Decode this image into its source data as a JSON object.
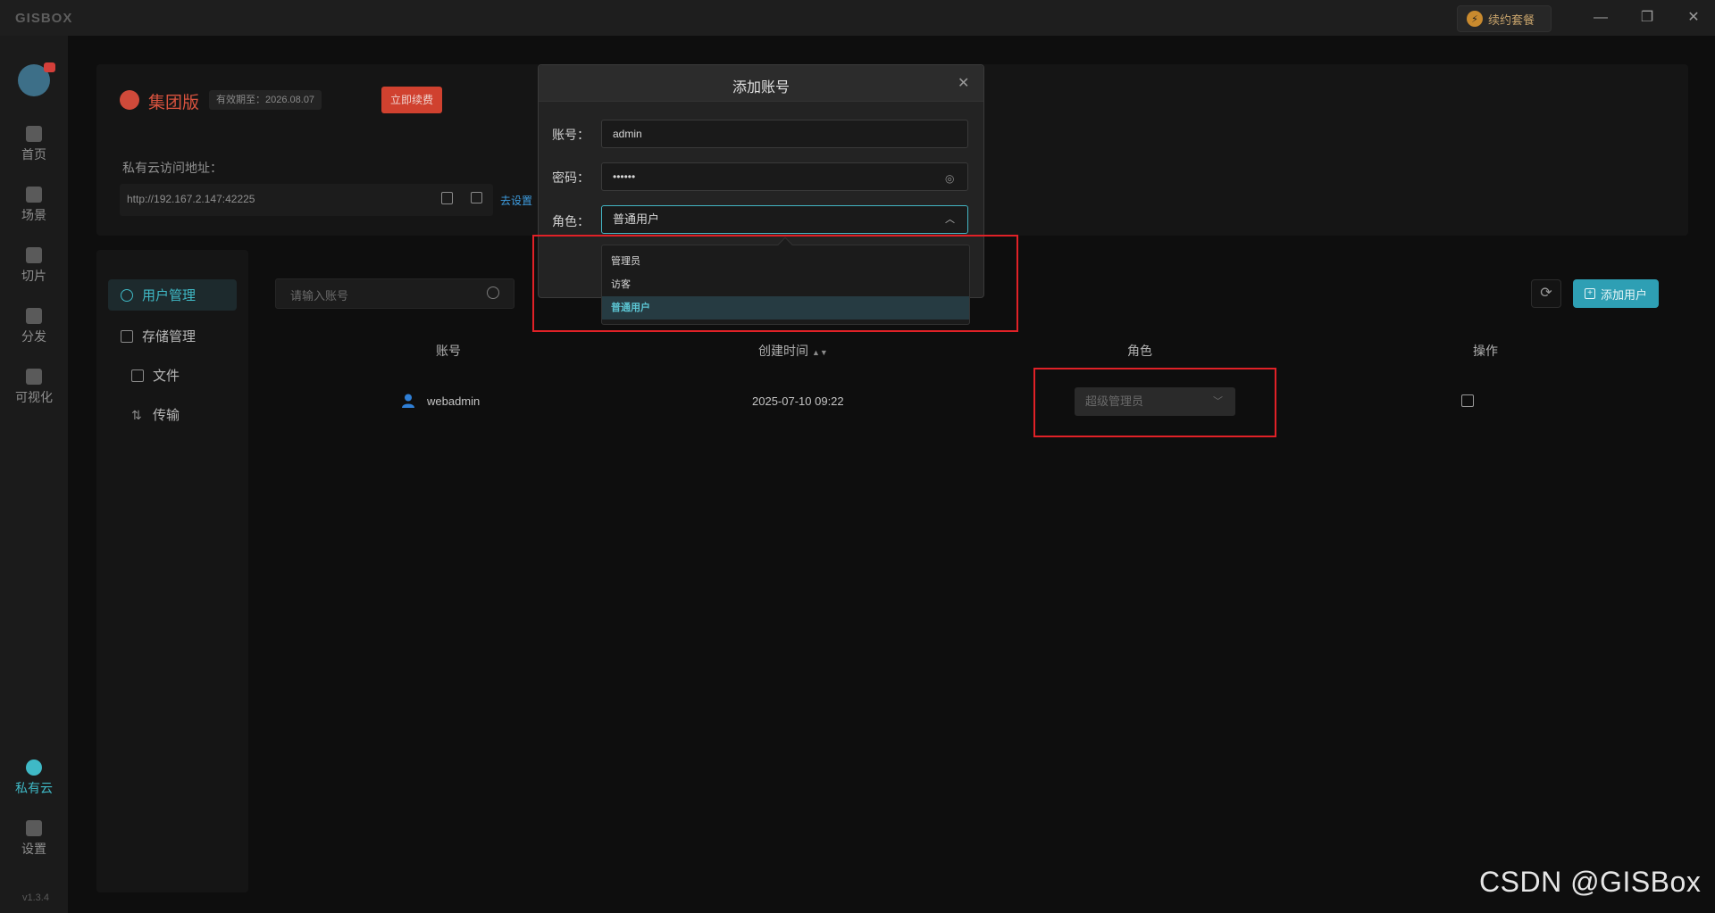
{
  "titlebar": {
    "logo": "GISBOX",
    "renew_package": "续约套餐",
    "minimize": "—",
    "restore": "❐",
    "close": "✕"
  },
  "rail": {
    "items": [
      {
        "label": "首页",
        "icon": "home-icon"
      },
      {
        "label": "场景",
        "icon": "cube-icon"
      },
      {
        "label": "切片",
        "icon": "slice-icon"
      },
      {
        "label": "分发",
        "icon": "publish-icon"
      },
      {
        "label": "可视化",
        "icon": "visualize-icon"
      },
      {
        "label": "私有云",
        "icon": "lock-icon"
      },
      {
        "label": "设置",
        "icon": "gear-icon"
      }
    ],
    "active": "私有云",
    "version": "v1.3.4"
  },
  "license": {
    "edition": "集团版",
    "expire": "有效期至：2026.08.07",
    "renew_now": "立即续费",
    "url_label": "私有云访问地址：",
    "url": "http://192.167.2.147:42225",
    "goto_setting": "去设置"
  },
  "subnav": {
    "user_mgmt": "用户管理",
    "storage_mgmt": "存储管理",
    "files": "文件",
    "transfer": "传输"
  },
  "toolbar": {
    "search_placeholder": "请输入账号",
    "add_user": "添加用户"
  },
  "table": {
    "headers": {
      "account": "账号",
      "created": "创建时间",
      "role": "角色",
      "action": "操作"
    },
    "rows": [
      {
        "account": "webadmin",
        "created": "2025-07-10 09:22",
        "role": "超级管理员"
      }
    ]
  },
  "modal": {
    "title": "添加账号",
    "account_label": "账号：",
    "account_value": "admin",
    "password_label": "密码：",
    "password_value": "••••••",
    "role_label": "角色：",
    "role_value": "普通用户",
    "role_options": [
      "管理员",
      "访客",
      "普通用户"
    ],
    "selected_option": "普通用户"
  },
  "watermark": "CSDN @GISBox",
  "colors": {
    "accent": "#3fb9c6",
    "highlight": "#e02127",
    "renew": "#d0412f"
  }
}
